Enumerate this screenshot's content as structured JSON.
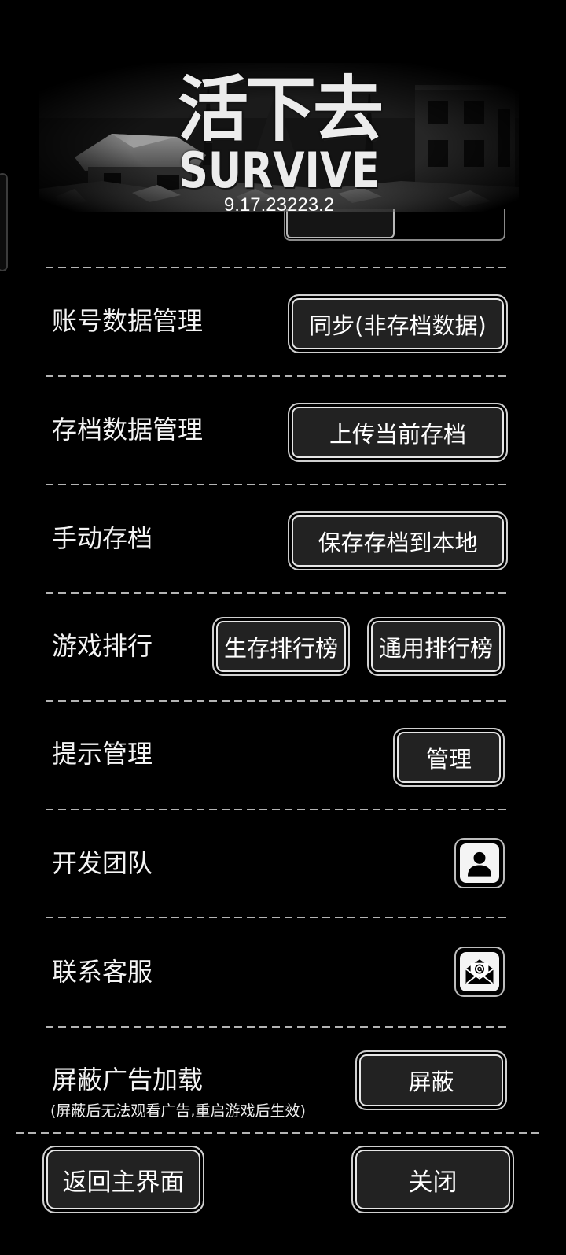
{
  "header": {
    "title": "活下去",
    "subtitle": "SURVIVE",
    "version": "9.17.23223.2"
  },
  "settings": {
    "account_data": {
      "label": "账号数据管理",
      "button": "同步(非存档数据)"
    },
    "save_data": {
      "label": "存档数据管理",
      "button": "上传当前存档"
    },
    "manual_save": {
      "label": "手动存档",
      "button": "保存存档到本地"
    },
    "leaderboard": {
      "label": "游戏排行",
      "buttons": [
        "生存排行榜",
        "通用排行榜"
      ]
    },
    "tips": {
      "label": "提示管理",
      "button": "管理"
    },
    "dev_team": {
      "label": "开发团队",
      "icon": "person-icon"
    },
    "support": {
      "label": "联系客服",
      "icon": "mail-icon"
    },
    "ads": {
      "label": "屏蔽广告加载",
      "note": "(屏蔽后无法观看广告,重启游戏后生效)",
      "button": "屏蔽"
    }
  },
  "footer": {
    "back": "返回主界面",
    "close": "关闭"
  },
  "colors": {
    "background": "#000000",
    "text": "#ffffff",
    "button_fill": "#222222",
    "button_border": "#e6e6e6",
    "divider": "#b4b4b4"
  }
}
